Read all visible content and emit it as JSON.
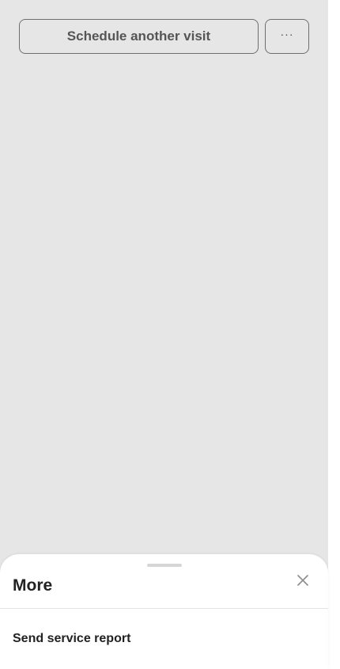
{
  "actions": {
    "schedule_label": "Schedule another visit",
    "more_label": "···"
  },
  "sheet": {
    "title": "More",
    "items": [
      {
        "label": "Send service report"
      }
    ]
  },
  "icons": {
    "more": "ellipsis-icon",
    "close": "close-icon",
    "grabber": "drag-handle"
  },
  "colors": {
    "backdrop": "#e6e6e6",
    "sheet": "#ffffff",
    "button_border": "#6e6e6e",
    "text": "#222222"
  }
}
